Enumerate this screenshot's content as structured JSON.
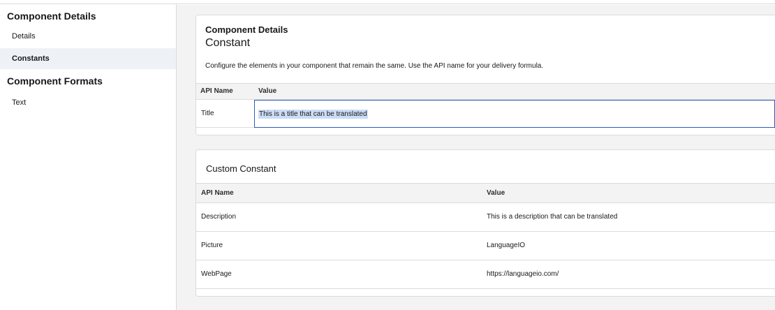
{
  "sidebar": {
    "section1": "Component Details",
    "items1": [
      "Details",
      "Constants"
    ],
    "section2": "Component Formats",
    "items2": [
      "Text"
    ],
    "selected": "Constants"
  },
  "constant_card": {
    "label": "Component Details",
    "title": "Constant",
    "description": "Configure the elements in your component that remain the same. Use the API name for your delivery formula.",
    "columns": [
      "API Name",
      "Value"
    ],
    "rows": [
      {
        "api_name": "Title",
        "value": "This is a title that can be translated"
      }
    ]
  },
  "custom_card": {
    "title": "Custom Constant",
    "columns": [
      "API Name",
      "Value"
    ],
    "rows": [
      {
        "api_name": "Description",
        "value": "This is a description that can be translated"
      },
      {
        "api_name": "Picture",
        "value": "LanguageIO"
      },
      {
        "api_name": "WebPage",
        "value": "https://languageio.com/"
      }
    ]
  },
  "colors": {
    "accent_border": "#2b5cb8",
    "selection_highlight": "#cbdcf5",
    "selected_nav_bg": "#eef2f7"
  }
}
